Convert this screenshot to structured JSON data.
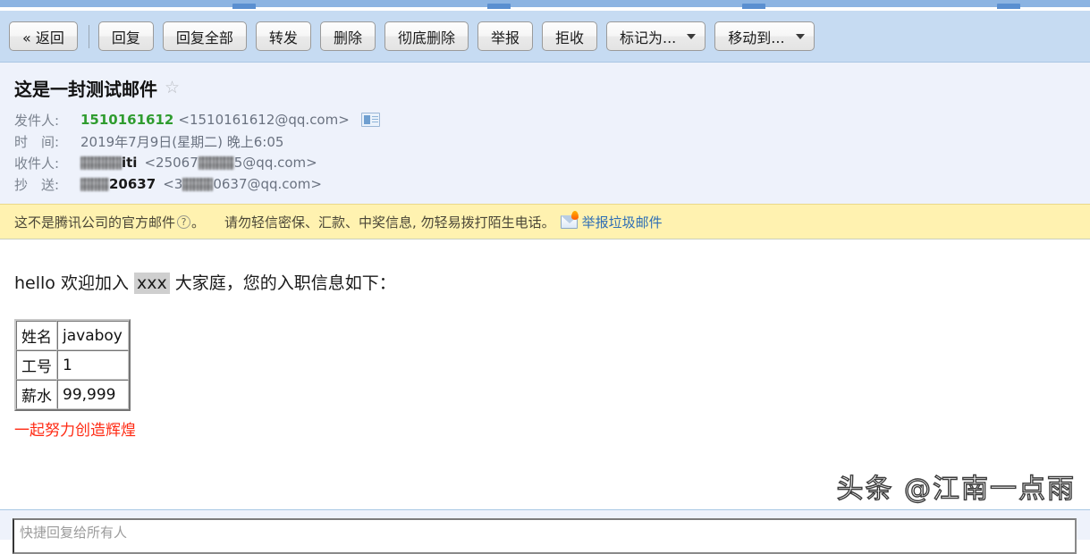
{
  "toolbar": {
    "buttons": [
      {
        "label": "« 返回",
        "name": "back-button",
        "caret": false
      },
      {
        "label": "回复",
        "name": "reply-button",
        "caret": false
      },
      {
        "label": "回复全部",
        "name": "reply-all-button",
        "caret": false
      },
      {
        "label": "转发",
        "name": "forward-button",
        "caret": false
      },
      {
        "label": "删除",
        "name": "delete-button",
        "caret": false
      },
      {
        "label": "彻底删除",
        "name": "delete-permanently-button",
        "caret": false
      },
      {
        "label": "举报",
        "name": "report-button",
        "caret": false
      },
      {
        "label": "拒收",
        "name": "reject-button",
        "caret": false
      },
      {
        "label": "标记为...",
        "name": "mark-as-dropdown",
        "caret": true
      },
      {
        "label": "移动到...",
        "name": "move-to-dropdown",
        "caret": true
      }
    ]
  },
  "mail": {
    "subject": "这是一封测试邮件",
    "star_glyph": "☆",
    "fields": {
      "from_label": "发件人:",
      "from_name": "1510161612",
      "from_address": "<1510161612@qq.com>",
      "time_label": "时　间:",
      "time_value": "2019年7月9日(星期二) 晚上6:05",
      "to_label": "收件人:",
      "to_prefix": "",
      "to_name_visible": "iti",
      "to_addr_prefix": "<25067",
      "to_addr_suffix": "5@qq.com>",
      "cc_label": "抄　送:",
      "cc_name_prefix": "",
      "cc_name_suffix": "20637",
      "cc_addr_prefix": "<3",
      "cc_addr_suffix": "0637@qq.com>"
    }
  },
  "warning": {
    "text_before": "这不是腾讯公司的官方邮件",
    "question_mark": "?",
    "period": "。",
    "text_after": "请勿轻信密保、汇款、中奖信息, 勿轻易拨打陌生电话。",
    "spam_link": "举报垃圾邮件",
    "bg_color": "#fff2b0",
    "link_color": "#2f6fb5"
  },
  "body": {
    "greeting_part1": "hello 欢迎加入 ",
    "greeting_highlight": "xxx",
    "greeting_part2": " 大家庭，您的入职信息如下：",
    "table": {
      "rows": [
        {
          "key": "姓名",
          "value": "javaboy"
        },
        {
          "key": "工号",
          "value": "1"
        },
        {
          "key": "薪水",
          "value": "99,999"
        }
      ]
    },
    "signoff": "一起努力创造辉煌",
    "signoff_color": "#ff2a13"
  },
  "watermark": {
    "text": "头条 @江南一点雨"
  },
  "footer": {
    "quick_reply_placeholder": "快捷回复给所有人"
  }
}
